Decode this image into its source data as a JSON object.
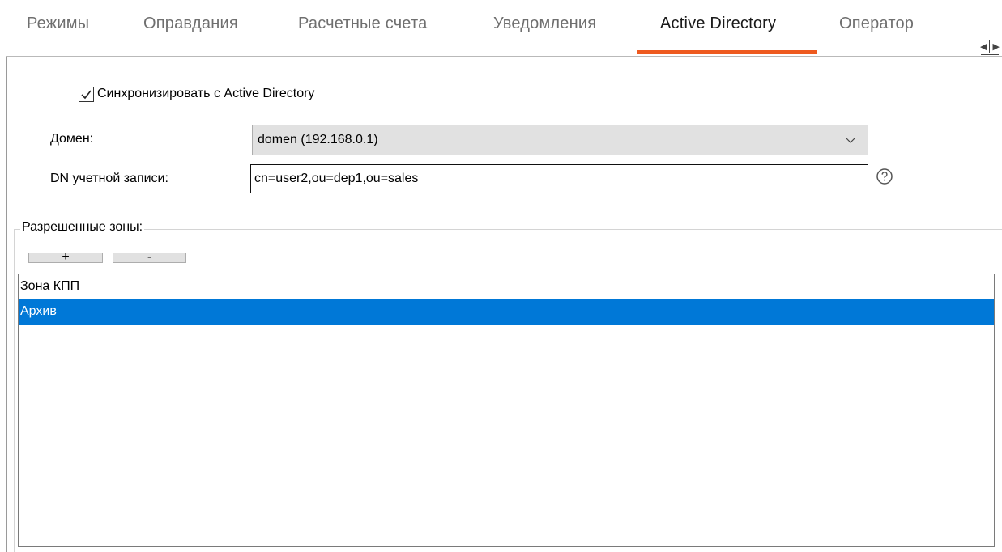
{
  "tabs": [
    {
      "label": "Режимы"
    },
    {
      "label": "Оправдания"
    },
    {
      "label": "Расчетные счета"
    },
    {
      "label": "Уведомления"
    },
    {
      "label": "Active Directory",
      "active": true
    },
    {
      "label": "Оператор"
    }
  ],
  "sync": {
    "label": "Синхронизировать с Active Directory",
    "checked": true
  },
  "domain": {
    "label": "Домен:",
    "value": "domen (192.168.0.1)"
  },
  "dn": {
    "label": "DN учетной записи:",
    "value": "cn=user2,ou=dep1,ou=sales"
  },
  "zones": {
    "title": "Разрешенные зоны:",
    "add_label": "+",
    "remove_label": "-",
    "items": [
      {
        "label": "Зона КПП",
        "selected": false
      },
      {
        "label": "Архив",
        "selected": true
      }
    ]
  },
  "colors": {
    "accent": "#ee5a1f",
    "selection": "#0078d7"
  }
}
